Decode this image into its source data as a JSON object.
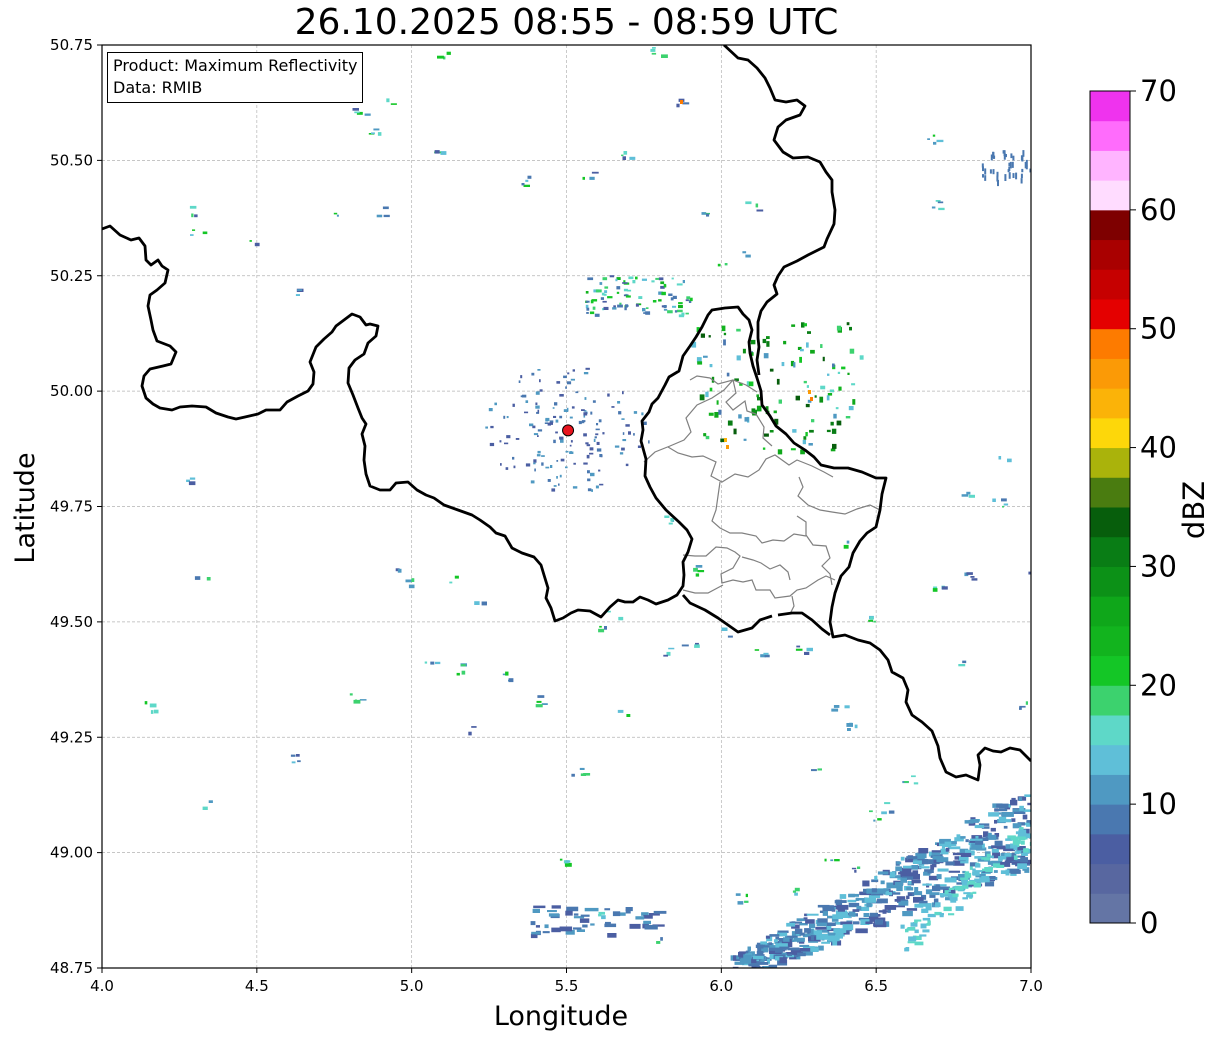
{
  "title": "26.10.2025 08:55 - 08:59 UTC",
  "info_box": {
    "product": "Product: Maximum Reflectivity",
    "data": "Data: RMIB"
  },
  "map": {
    "xlabel": "Longitude",
    "ylabel": "Latitude",
    "xlim": [
      4.0,
      7.0
    ],
    "ylim": [
      48.75,
      50.75
    ],
    "xticks": [
      "4.0",
      "4.5",
      "5.0",
      "5.5",
      "6.0",
      "6.5",
      "7.0"
    ],
    "yticks": [
      "48.75",
      "49.00",
      "49.25",
      "49.50",
      "49.75",
      "50.00",
      "50.25",
      "50.50",
      "50.75"
    ],
    "grid": true,
    "radar_site": {
      "lon": 5.505,
      "lat": 49.915,
      "color": "#e8141e"
    }
  },
  "colorbar": {
    "label": "dBZ",
    "range": [
      0,
      70
    ],
    "step": 2.5,
    "tick_labels": [
      "0",
      "10",
      "20",
      "30",
      "40",
      "50",
      "60",
      "70"
    ],
    "colors": [
      "#6475a5",
      "#5867a0",
      "#4b5ea2",
      "#4a78b0",
      "#4f99c2",
      "#5fbfd8",
      "#5ed8c8",
      "#3cd26e",
      "#14c626",
      "#12b41e",
      "#0fa71a",
      "#0c9117",
      "#097d15",
      "#075e0c",
      "#4a7c10",
      "#aab30b",
      "#fdd70a",
      "#fbb308",
      "#fb9a06",
      "#fd7b00",
      "#e40000",
      "#c60000",
      "#a90000",
      "#7e0000",
      "#ffdcff",
      "#ffb4ff",
      "#ff6cfc",
      "#ef33ee"
    ]
  },
  "colors": {
    "border": "#000000",
    "regions": "#808080",
    "grid": "#b4b4b4"
  }
}
